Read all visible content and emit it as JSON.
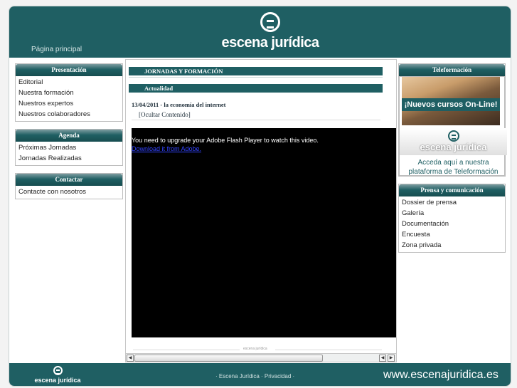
{
  "header": {
    "home_label": "Página principal",
    "logo_text": "escena jurídica"
  },
  "left": {
    "presentacion": {
      "title": "Presentación",
      "items": [
        "Editorial",
        "Nuestra formación",
        "Nuestros expertos",
        "Nuestros colaboradores"
      ]
    },
    "agenda": {
      "title": "Agenda",
      "items": [
        "Próximas Jornadas",
        "Jornadas Realizadas"
      ]
    },
    "contactar": {
      "title": "Contactar",
      "items": [
        "Contacte con nosotros"
      ]
    }
  },
  "center": {
    "section_title": "JORNADAS Y FORMACIÓN",
    "subsection_title": "Actualidad",
    "news_date_title": "13/04/2011 - la economía del internet",
    "hide_link": "[Ocultar Contenido]",
    "flash_message": "You need to upgrade your Adobe Flash Player to watch this video.",
    "flash_link": "Download it from Adobe.",
    "footer_logo": "escena jurídica"
  },
  "right": {
    "teleformacion": {
      "title": "Teleformación",
      "banner": "¡Nuevos cursos On-Line!",
      "logo_text": "escena jurídica",
      "promo_line1": "Acceda aquí a nuestra",
      "promo_line2": "plataforma de Teleformación"
    },
    "prensa": {
      "title": "Prensa y comunicación",
      "items": [
        "Dossier de prensa",
        "Galería",
        "Documentación",
        "Encuesta",
        "Zona privada"
      ]
    }
  },
  "footer": {
    "logo_text": "escena jurídica",
    "links_prefix": "· ",
    "link1": "Escena Jurídica",
    "link_sep": " · ",
    "link2": "Privacidad",
    "links_suffix": " ·",
    "url": "www.escenajuridica.es"
  },
  "colors": {
    "brand": "#1f5f63",
    "flash_bg": "#000000",
    "link": "#3344ff"
  }
}
